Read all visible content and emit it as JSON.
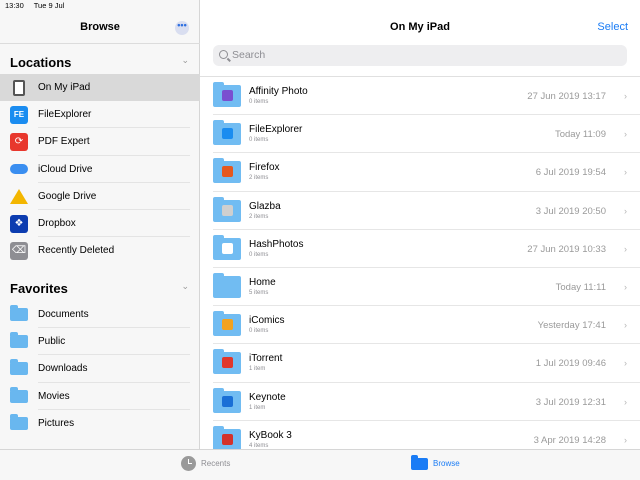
{
  "status": {
    "time": "13:30",
    "date": "Tue 9 Jul"
  },
  "sidebar": {
    "title": "Browse",
    "more_glyph": "•••",
    "locations_label": "Locations",
    "favorites_label": "Favorites",
    "locations": [
      {
        "label": "On My iPad",
        "icon": "ipad-icon",
        "active": true
      },
      {
        "label": "FileExplorer",
        "icon": "fileexplorer-icon"
      },
      {
        "label": "PDF Expert",
        "icon": "pdf-expert-icon"
      },
      {
        "label": "iCloud Drive",
        "icon": "icloud-icon"
      },
      {
        "label": "Google Drive",
        "icon": "google-drive-icon"
      },
      {
        "label": "Dropbox",
        "icon": "dropbox-icon"
      },
      {
        "label": "Recently Deleted",
        "icon": "trash-icon"
      }
    ],
    "favorites": [
      {
        "label": "Documents"
      },
      {
        "label": "Public"
      },
      {
        "label": "Downloads"
      },
      {
        "label": "Movies"
      },
      {
        "label": "Pictures"
      }
    ]
  },
  "main": {
    "title": "On My iPad",
    "select_label": "Select",
    "search_placeholder": "Search",
    "files": [
      {
        "name": "Affinity Photo",
        "count": "0 items",
        "date": "27 Jun 2019 13:17",
        "badge_color": "#7a4fd0"
      },
      {
        "name": "FileExplorer",
        "count": "0 items",
        "date": "Today 11:09",
        "badge_color": "#1a8cf0"
      },
      {
        "name": "Firefox",
        "count": "2 items",
        "date": "6 Jul 2019 19:54",
        "badge_color": "#e5581f"
      },
      {
        "name": "Glazba",
        "count": "2 items",
        "date": "3 Jul 2019 20:50",
        "badge_color": "#cfcfcf"
      },
      {
        "name": "HashPhotos",
        "count": "0 items",
        "date": "27 Jun 2019 10:33",
        "badge_color": "#ffffff"
      },
      {
        "name": "Home",
        "count": "5 items",
        "date": "Today 11:11",
        "badge_color": ""
      },
      {
        "name": "iComics",
        "count": "0 items",
        "date": "Yesterday 17:41",
        "badge_color": "#f3a21f"
      },
      {
        "name": "iTorrent",
        "count": "1 item",
        "date": "1 Jul 2019 09:46",
        "badge_color": "#e0372b"
      },
      {
        "name": "Keynote",
        "count": "1 item",
        "date": "3 Jul 2019 12:31",
        "badge_color": "#1a6fd6"
      },
      {
        "name": "KyBook 3",
        "count": "4 items",
        "date": "3 Apr 2019 14:28",
        "badge_color": "#d4322a"
      }
    ]
  },
  "tabbar": {
    "recents_label": "Recents",
    "browse_label": "Browse"
  }
}
